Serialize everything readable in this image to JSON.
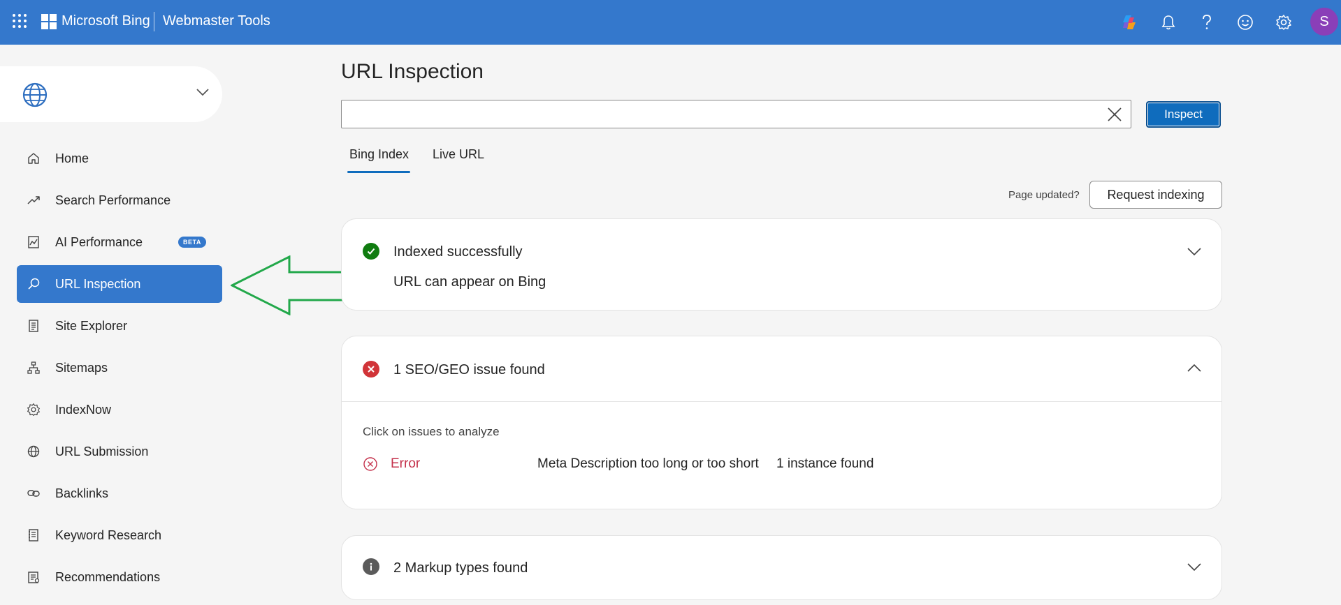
{
  "header": {
    "brand": "Microsoft Bing",
    "product": "Webmaster Tools",
    "avatar_initial": "S",
    "accent_color": "#3478cc"
  },
  "sidebar": {
    "site_picker": {
      "value": ""
    },
    "items": [
      {
        "label": "Home",
        "icon": "home-icon"
      },
      {
        "label": "Search Performance",
        "icon": "trend-icon"
      },
      {
        "label": "AI Performance",
        "icon": "chart-icon",
        "badge": "BETA"
      },
      {
        "label": "URL Inspection",
        "icon": "search-icon",
        "active": true
      },
      {
        "label": "Site Explorer",
        "icon": "document-icon"
      },
      {
        "label": "Sitemaps",
        "icon": "sitemap-icon"
      },
      {
        "label": "IndexNow",
        "icon": "gear-icon"
      },
      {
        "label": "URL Submission",
        "icon": "globe-icon"
      },
      {
        "label": "Backlinks",
        "icon": "link-icon"
      },
      {
        "label": "Keyword Research",
        "icon": "notebook-icon"
      },
      {
        "label": "Recommendations",
        "icon": "clipboard-icon"
      }
    ]
  },
  "main": {
    "title": "URL Inspection",
    "url_input": {
      "value": "",
      "placeholder": ""
    },
    "inspect_label": "Inspect",
    "tabs": [
      {
        "label": "Bing Index",
        "active": true
      },
      {
        "label": "Live URL",
        "active": false
      }
    ],
    "page_updated": "Page updated?",
    "request_indexing_label": "Request indexing",
    "index_card": {
      "title": "Indexed successfully",
      "subtitle": "URL can appear on Bing",
      "status_color": "#107c10"
    },
    "issues_card": {
      "title": "1 SEO/GEO issue found",
      "hint": "Click on issues to analyze",
      "status_color": "#d13438",
      "issues": [
        {
          "severity": "Error",
          "name": "Meta Description too long or too short",
          "count": "1 instance found"
        }
      ]
    },
    "markup_card": {
      "title": "2 Markup types found"
    }
  },
  "annotation": {
    "arrow_color": "#22a84a"
  }
}
